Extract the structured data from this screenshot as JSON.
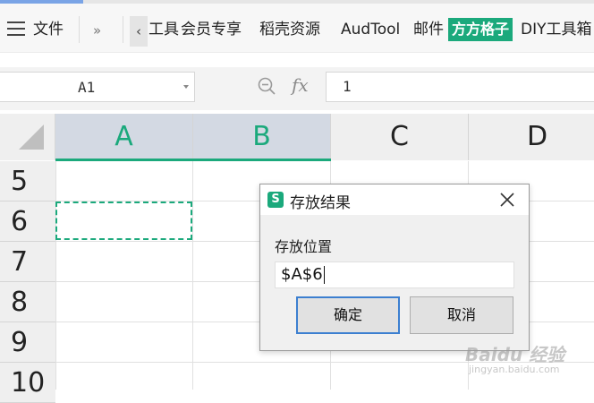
{
  "ribbon": {
    "file_menu": "文件",
    "expand": "»",
    "scroll_left": "‹",
    "items": [
      "工具",
      "会员专享",
      "稻壳资源",
      "AudTool",
      "邮件"
    ],
    "highlight_item": "方方格子",
    "last_item": "DIY工具箱"
  },
  "formula_bar": {
    "name_box": "A1",
    "fx_label": "fx",
    "formula_value": "1"
  },
  "sheet": {
    "columns": [
      "A",
      "B",
      "C",
      "D"
    ],
    "rows": [
      "5",
      "6",
      "7",
      "8",
      "9",
      "10"
    ]
  },
  "dialog": {
    "icon_letter": "S",
    "title": "存放结果",
    "label": "存放位置",
    "input_value": "$A$6",
    "ok_label": "确定",
    "cancel_label": "取消"
  },
  "watermark": {
    "brand": "Baidu 经验",
    "url": "jingyan.baidu.com"
  },
  "colors": {
    "accent_green": "#1ba97c",
    "selected_header_bg": "#d3d9e3",
    "focus_blue": "#3c7fd0"
  }
}
